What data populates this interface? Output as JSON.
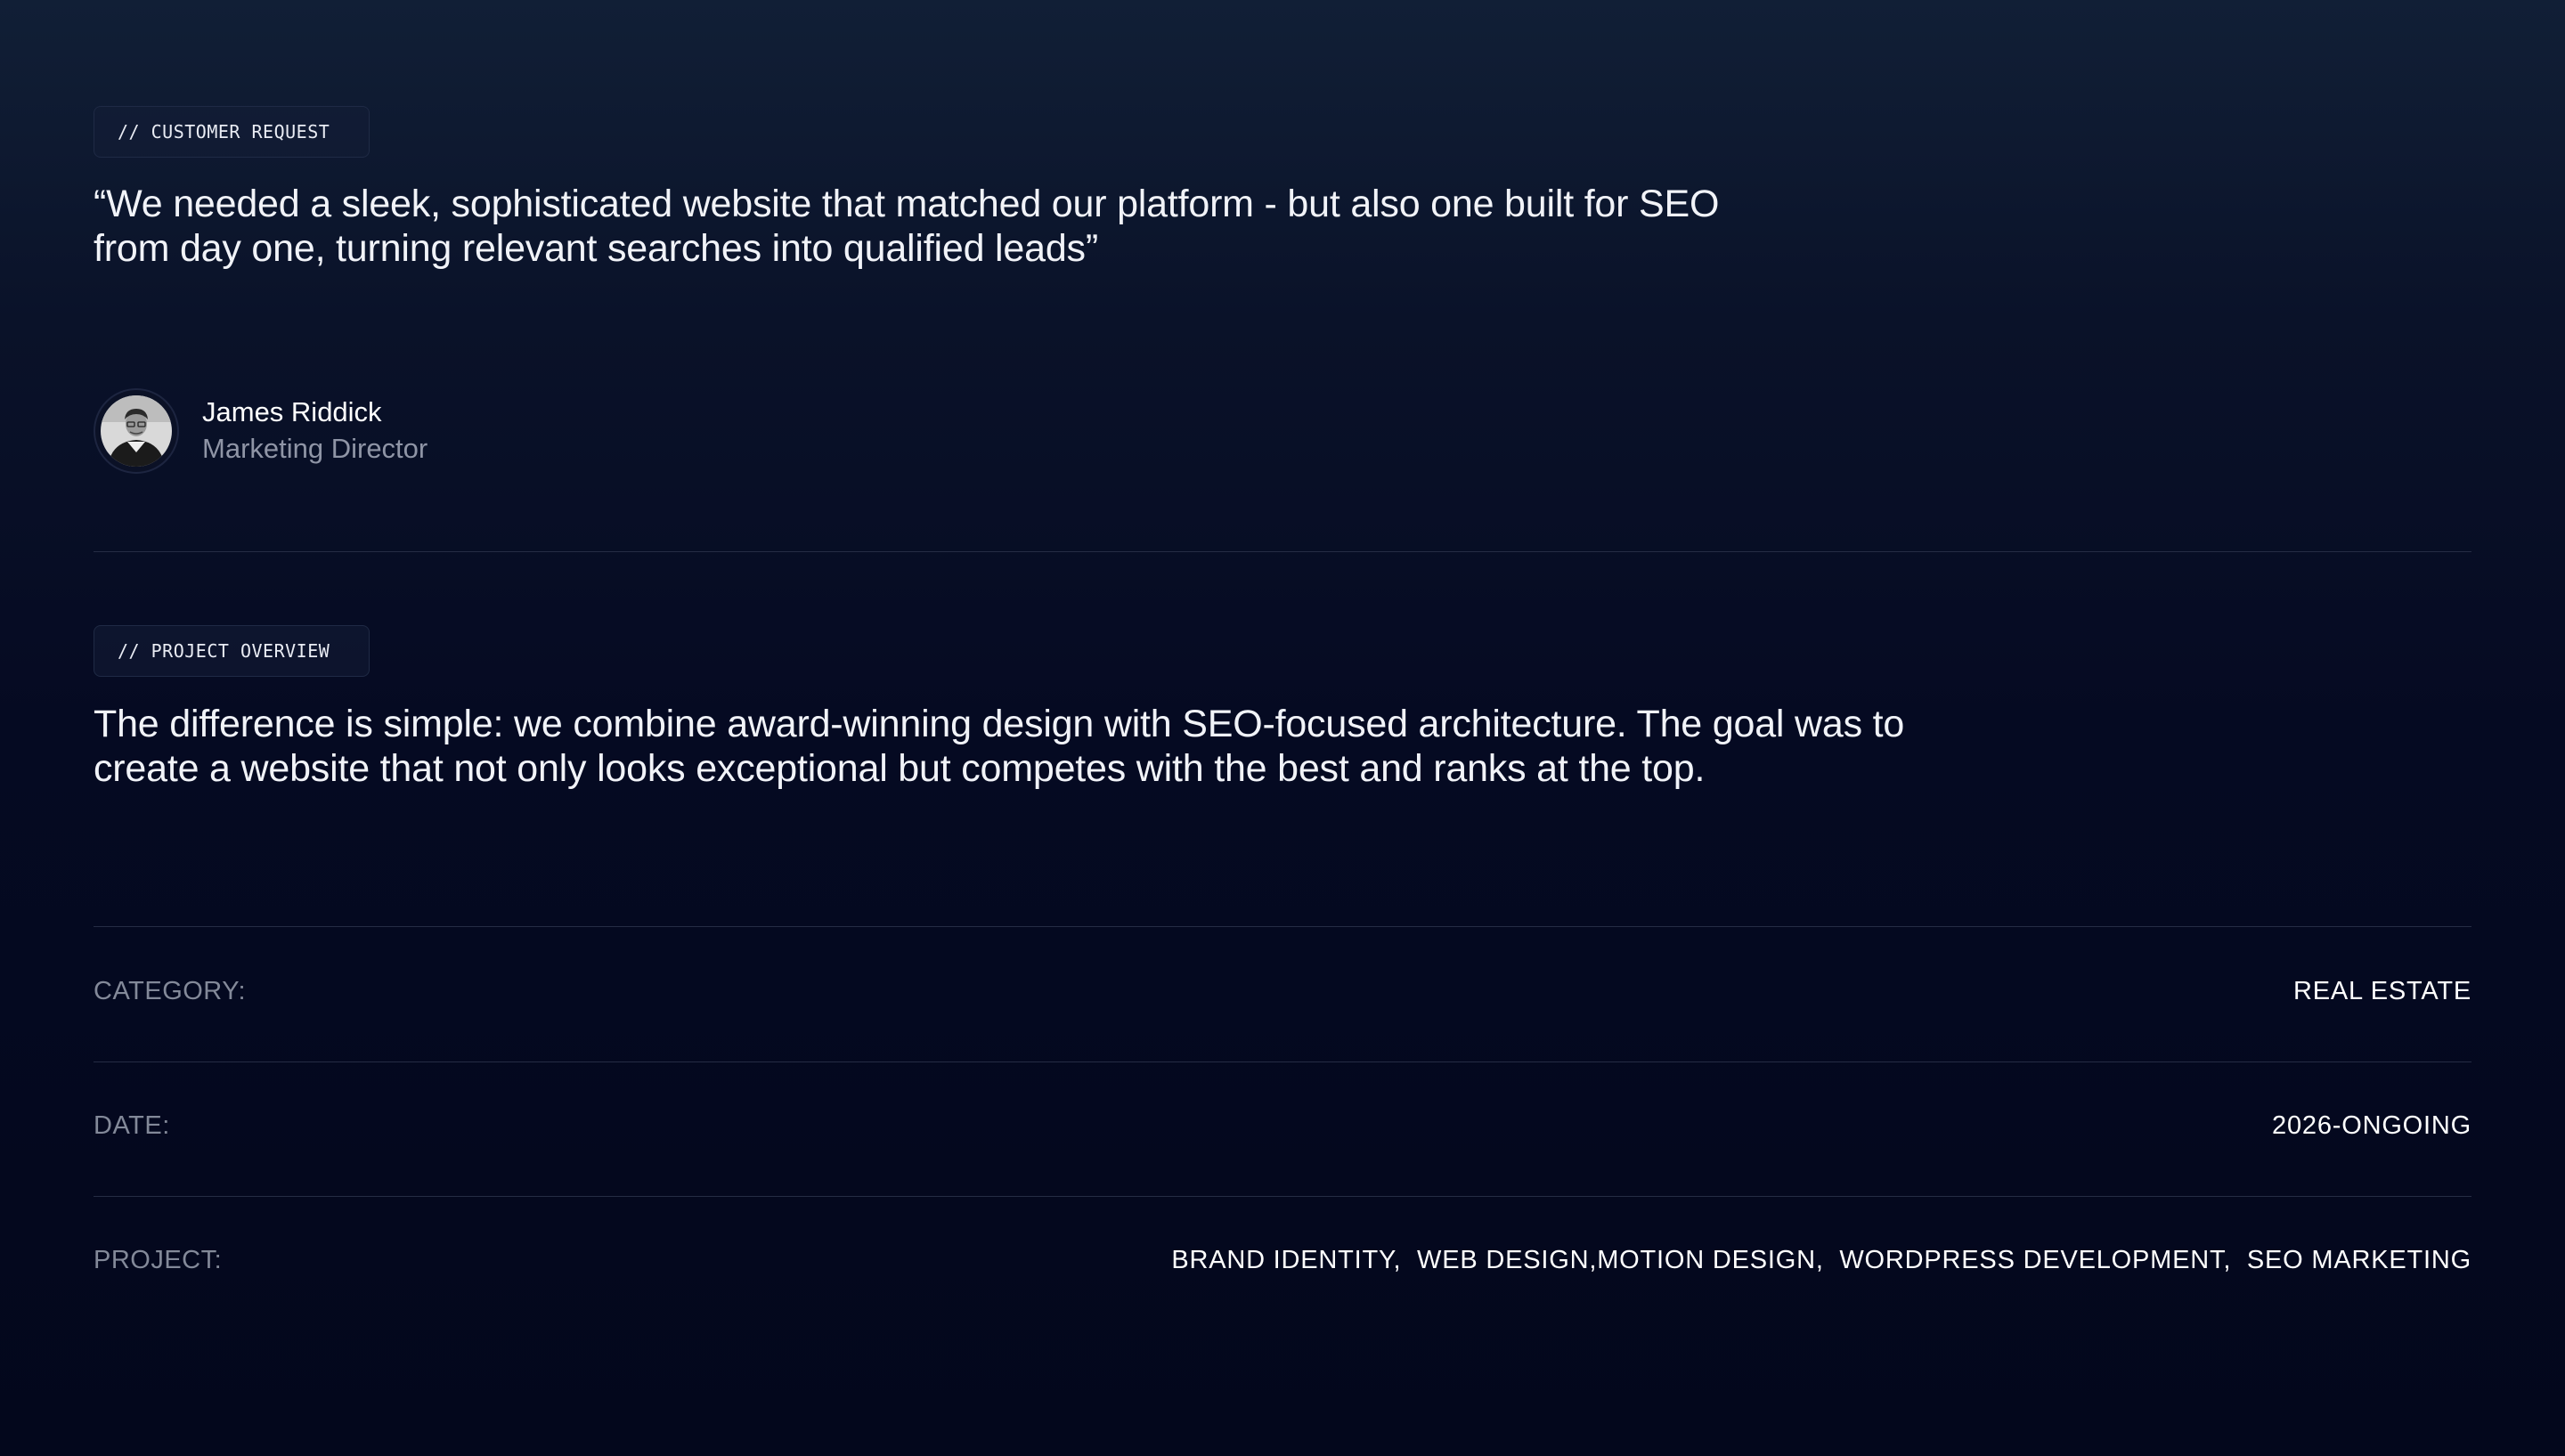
{
  "customer_request": {
    "tag": "// CUSTOMER REQUEST",
    "quote": "“We needed a sleek, sophisticated website that matched our platform - but also one built for SEO from day one, turning relevant searches into qualified leads”",
    "author": {
      "name": "James Riddick",
      "role": "Marketing Director"
    }
  },
  "project_overview": {
    "tag": "// PROJECT OVERVIEW",
    "text": "The difference is simple: we combine award-winning design with SEO-focused architecture. The goal was to create a website that not only looks exceptional but competes with the best and ranks at the top."
  },
  "details": {
    "category": {
      "label": "CATEGORY:",
      "value": "REAL ESTATE"
    },
    "date": {
      "label": "DATE:",
      "value": "2026-ONGOING"
    },
    "project": {
      "label": "PROJECT:",
      "value": "BRAND IDENTITY,  WEB DESIGN,MOTION DESIGN,  WORDPRESS DEVELOPMENT,  SEO MARKETING"
    }
  }
}
